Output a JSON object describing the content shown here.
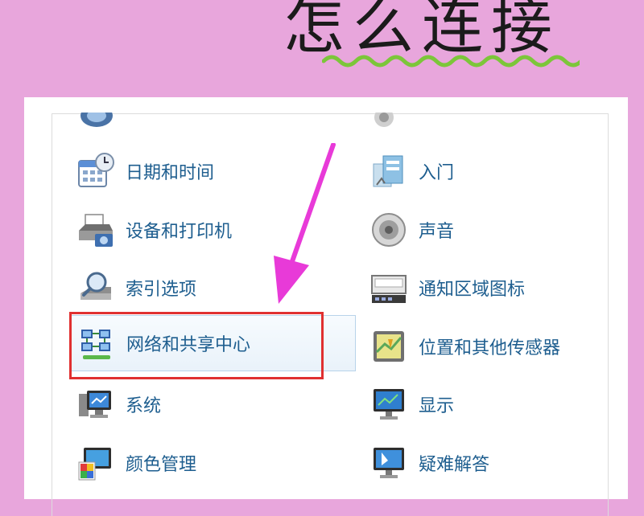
{
  "headline": "怎么连接",
  "left_items": [
    {
      "label": "日期和时间",
      "icon": "calendar-clock-icon"
    },
    {
      "label": "设备和打印机",
      "icon": "printer-icon"
    },
    {
      "label": "索引选项",
      "icon": "index-search-icon"
    },
    {
      "label": "网络和共享中心",
      "icon": "network-icon"
    },
    {
      "label": "系统",
      "icon": "computer-icon"
    },
    {
      "label": "颜色管理",
      "icon": "color-management-icon"
    }
  ],
  "right_items": [
    {
      "label": "入门",
      "icon": "getting-started-icon"
    },
    {
      "label": "声音",
      "icon": "speaker-icon"
    },
    {
      "label": "通知区域图标",
      "icon": "notification-tray-icon"
    },
    {
      "label": "位置和其他传感器",
      "icon": "location-sensor-icon"
    },
    {
      "label": "显示",
      "icon": "display-icon"
    },
    {
      "label": "疑难解答",
      "icon": "troubleshoot-icon"
    }
  ],
  "colors": {
    "background": "#e8a6dc",
    "link": "#1e5e8f",
    "highlight_border": "#e03030",
    "arrow": "#e83ad8",
    "squiggle": "#7cc63a"
  }
}
